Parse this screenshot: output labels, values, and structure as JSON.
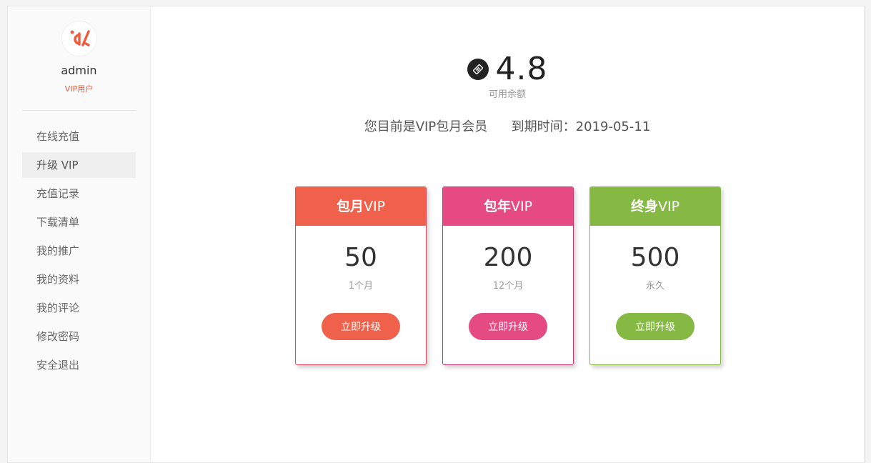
{
  "profile": {
    "username": "admin",
    "role": "VIP用户",
    "avatar_icon": "brand-logo-icon",
    "brand_color": "#ef5a3c"
  },
  "sidebar": {
    "items": [
      {
        "label": "在线充值",
        "active": false
      },
      {
        "label": "升级 VIP",
        "active": true
      },
      {
        "label": "充值记录",
        "active": false
      },
      {
        "label": "下载清单",
        "active": false
      },
      {
        "label": "我的推广",
        "active": false
      },
      {
        "label": "我的资料",
        "active": false
      },
      {
        "label": "我的评论",
        "active": false
      },
      {
        "label": "修改密码",
        "active": false
      },
      {
        "label": "安全退出",
        "active": false
      }
    ]
  },
  "balance": {
    "value": "4.8",
    "label": "可用余额",
    "icon": "coin-icon"
  },
  "membership": {
    "status": "您目前是VIP包月会员",
    "expiry_label": "到期时间：",
    "expiry_date": "2019-05-11"
  },
  "plans": [
    {
      "name_cn": "包月",
      "name_suffix": "VIP",
      "price": "50",
      "term": "1个月",
      "button": "立即升级",
      "color": "#f0614b",
      "border": "#e8465a"
    },
    {
      "name_cn": "包年",
      "name_suffix": "VIP",
      "price": "200",
      "term": "12个月",
      "button": "立即升级",
      "color": "#e64a82",
      "border": "#c8386e"
    },
    {
      "name_cn": "终身",
      "name_suffix": "VIP",
      "price": "500",
      "term": "永久",
      "button": "立即升级",
      "color": "#86b944",
      "border": "#86b944"
    }
  ]
}
